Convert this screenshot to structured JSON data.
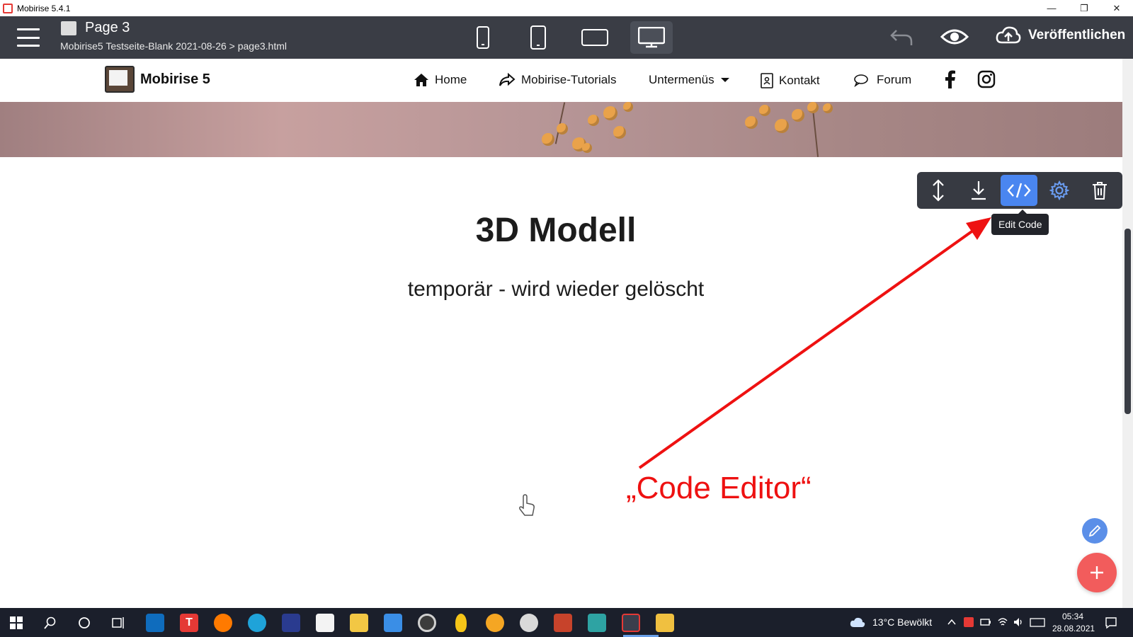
{
  "window": {
    "title": "Mobirise 5.4.1"
  },
  "topbar": {
    "page_name": "Page 3",
    "page_path": "Mobirise5 Testseite-Blank 2021-08-26 > page3.html",
    "publish_label": "Veröffentlichen"
  },
  "site_nav": {
    "brand": "Mobirise 5",
    "items": [
      {
        "label": "Home",
        "icon": "home-icon"
      },
      {
        "label": "Mobirise-Tutorials",
        "icon": "share-icon"
      },
      {
        "label": "Untermenüs",
        "icon": "chevron-down-icon"
      },
      {
        "label": "Kontakt",
        "icon": "contact-icon"
      },
      {
        "label": "Forum",
        "icon": "chat-icon"
      }
    ]
  },
  "content": {
    "title": "3D Modell",
    "subtitle": "temporär - wird wieder gelöscht"
  },
  "block_toolbar": {
    "buttons": [
      "move-icon",
      "download-icon",
      "code-icon",
      "gear-icon",
      "trash-icon"
    ],
    "tooltip": "Edit Code"
  },
  "annotation": {
    "text": "„Code Editor“",
    "color": "#ee1111"
  },
  "taskbar": {
    "weather": "13°C  Bewölkt",
    "time": "05:34",
    "date": "28.08.2021"
  },
  "colors": {
    "topbar": "#3a3d45",
    "accent": "#4a86f0",
    "fab_add": "#f25c5c",
    "taskbar": "#1b1f2b"
  }
}
